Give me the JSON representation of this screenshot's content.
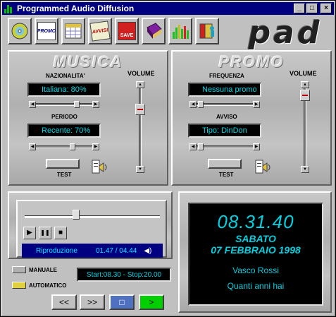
{
  "window": {
    "title": "Programmed Audio Diffusion",
    "minimize_glyph": "_",
    "maximize_glyph": "□",
    "close_glyph": "×"
  },
  "toolbar": {
    "buttons": [
      {
        "icon": "cd-disc-icon"
      },
      {
        "icon": "promo-icon",
        "label": "PROMO"
      },
      {
        "icon": "calendar-icon"
      },
      {
        "icon": "avvisi-icon",
        "label": "AVVISI"
      },
      {
        "icon": "save-icon",
        "label": "SAVE"
      },
      {
        "icon": "book-icon"
      },
      {
        "icon": "equalizer-icon"
      },
      {
        "icon": "exit-door-icon"
      }
    ]
  },
  "logo": {
    "text": "pad"
  },
  "musica": {
    "header": "MUSICA",
    "nazionalita_label": "NAZIONALITA'",
    "nazionalita_value": "Italiana: 80%",
    "periodo_label": "PERIODO",
    "periodo_value": "Recente: 70%",
    "volume_label": "VOLUME",
    "test_label": "TEST"
  },
  "promo": {
    "header": "PROMO",
    "frequenza_label": "FREQUENZA",
    "frequenza_value": "Nessuna promo",
    "avviso_label": "AVVISO",
    "avviso_value": "Tipo: DinDon",
    "volume_label": "VOLUME",
    "test_label": "TEST"
  },
  "player": {
    "status_label": "Riproduzione",
    "time": "01.47 / 04.44",
    "play_glyph": "▶",
    "pause_glyph": "❚❚",
    "stop_glyph": "■"
  },
  "clock": {
    "time": "08.31.40",
    "day": "SABATO",
    "date": "07 FEBBRAIO 1998",
    "artist": "Vasco Rossi",
    "song": "Quanti anni hai"
  },
  "mode": {
    "manuale_label": "MANUALE",
    "automatico_label": "AUTOMATICO",
    "schedule": "Start:08.30 - Stop:20.00"
  },
  "nav": {
    "rewind_glyph": "<<",
    "forward_glyph": ">>",
    "stop_glyph": "□",
    "play_glyph": ">"
  },
  "colors": {
    "lcd_text": "#00d8e8",
    "title_bar": "#000080",
    "play_green": "#00d000",
    "stop_blue": "#5070c0"
  }
}
